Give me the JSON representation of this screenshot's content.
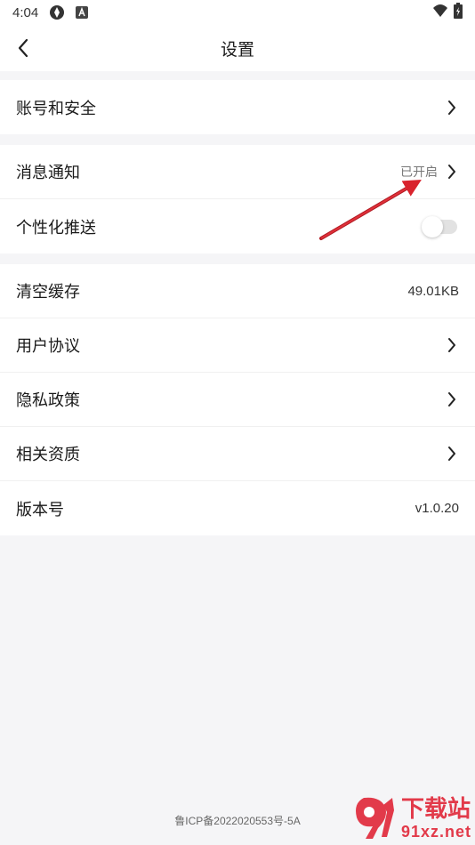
{
  "status_bar": {
    "time": "4:04",
    "icons": [
      "sync-icon",
      "app-a-icon"
    ],
    "right_icons": [
      "wifi-icon",
      "battery-icon"
    ]
  },
  "header": {
    "title": "设置",
    "back_icon": "chevron-left-icon"
  },
  "groups": [
    {
      "rows": [
        {
          "label": "账号和安全",
          "value": "",
          "chevron": true
        }
      ]
    },
    {
      "rows": [
        {
          "label": "消息通知",
          "value": "已开启",
          "chevron": true
        },
        {
          "label": "个性化推送",
          "toggle": false
        }
      ]
    },
    {
      "rows": [
        {
          "label": "清空缓存",
          "value": "49.01KB",
          "chevron": false
        },
        {
          "label": "用户协议",
          "chevron": true
        },
        {
          "label": "隐私政策",
          "chevron": true
        },
        {
          "label": "相关资质",
          "chevron": true
        },
        {
          "label": "版本号",
          "value": "v1.0.20",
          "chevron": false
        }
      ]
    }
  ],
  "footer": {
    "icp": "鲁ICP备2022020553号-5A"
  },
  "watermark": {
    "line1": "下载站",
    "line2": "91xz.net"
  },
  "colors": {
    "accent_annotation": "#d9232d",
    "background": "#f5f5f7",
    "toggle_off": "#e2e2e2",
    "watermark": "#e23a4a"
  }
}
